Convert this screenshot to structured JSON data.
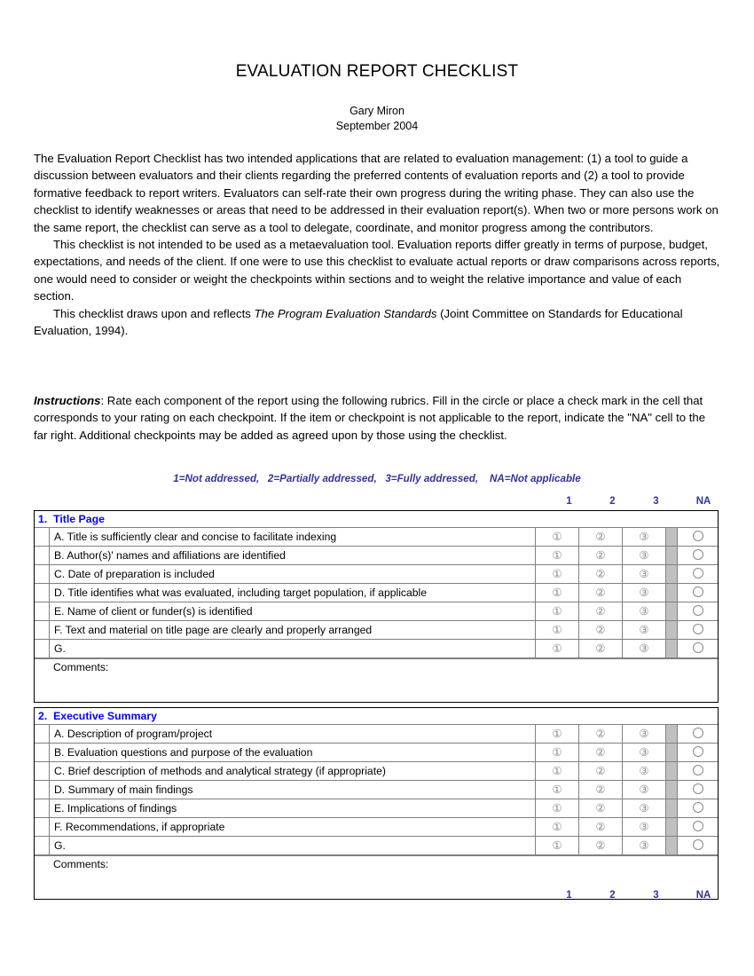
{
  "document": {
    "title": "EVALUATION REPORT CHECKLIST",
    "author": "Gary Miron",
    "date": "September 2004"
  },
  "intro": {
    "paragraph_1": "The Evaluation Report Checklist has two intended applications that are related to evaluation management: (1) a tool to guide a discussion between evaluators and their clients regarding the preferred contents of evaluation reports and (2) a tool to provide formative feedback to report writers.  Evaluators can self-rate their own progress during the writing phase.  They can also use the checklist to identify weaknesses or areas that need to be addressed in their evaluation report(s).  When two or more persons work on the same report, the checklist can serve as a tool to delegate, coordinate, and monitor progress among the contributors.",
    "paragraph_2": "This checklist is not intended to be used as a metaevaluation tool.  Evaluation reports differ greatly in terms of purpose, budget, expectations, and needs of the client.  If one were to use this checklist to evaluate actual reports or draw comparisons across reports, one would need to consider or weight the checkpoints within sections and to weight the relative importance and value of each section.",
    "paragraph_3_before": "This checklist draws upon and reflects ",
    "paragraph_3_italic": "The Program Evaluation Standards",
    "paragraph_3_after": " (Joint Committee on Standards for Educational Evaluation, 1994)."
  },
  "instructions": {
    "lead": "Instructions",
    "text": ":  Rate each component of the report using the following rubrics.  Fill in the circle or place a check mark in the cell that corresponds to your rating on each checkpoint.  If the item or checkpoint is not applicable to the report, indicate the \"NA\" cell to the far right.  Additional checkpoints may be added as agreed upon by those using the checklist."
  },
  "legend": "1=Not addressed,   2=Partially addressed,   3=Fully addressed,    NA=Not applicable",
  "scale": {
    "col1": "1",
    "col2": "2",
    "col3": "3",
    "na": "NA",
    "glyph_1": "①",
    "glyph_2": "②",
    "glyph_3": "③"
  },
  "comments_label": "Comments:",
  "colors": {
    "section_header_blue": "#0000ff",
    "scale_label_blue": "#33339e",
    "grid_gray": "#808080",
    "spacer_gray": "#c0c0c0",
    "circle_gray": "#8a8a8a"
  },
  "sections": [
    {
      "number": "1.",
      "title": "Title Page",
      "header": "1.  Title Page",
      "items": [
        "A.  Title is sufficiently clear and concise to facilitate indexing",
        "B.  Author(s)' names and affiliations are identified",
        "C.  Date of preparation is included",
        "D.  Title identifies what was evaluated, including target population, if applicable",
        "E.  Name of client or funder(s) is identified",
        "F.  Text and material on title page are clearly and properly arranged",
        "G."
      ]
    },
    {
      "number": "2.",
      "title": "Executive Summary",
      "header": "2.  Executive Summary",
      "items": [
        "A.  Description of program/project",
        "B.  Evaluation questions and purpose of the evaluation",
        "C.  Brief description of methods and analytical strategy (if appropriate)",
        "D.  Summary of main findings",
        "E.  Implications of findings",
        "F.  Recommendations, if appropriate",
        "G."
      ]
    }
  ]
}
